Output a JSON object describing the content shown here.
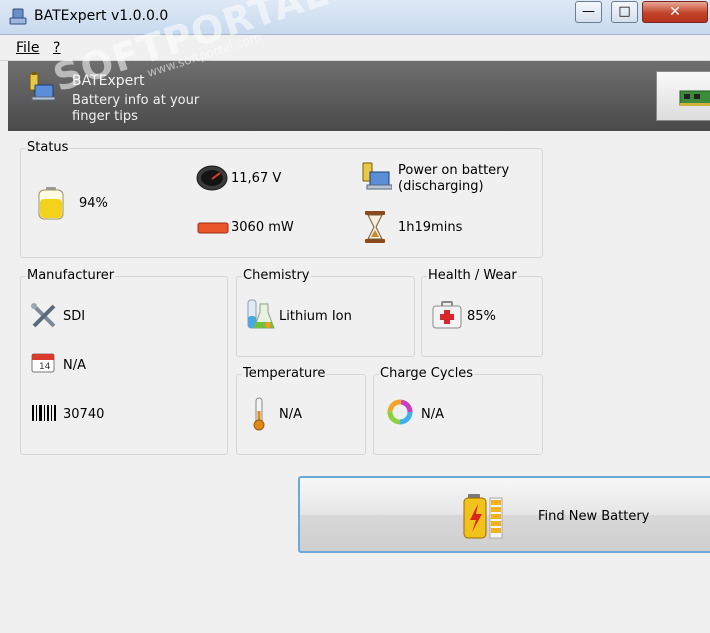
{
  "window": {
    "title": "BATExpert v1.0.0.0",
    "min_glyph": "—",
    "max_glyph": "□",
    "close_glyph": "✕"
  },
  "menu": {
    "file": "File",
    "help": "?"
  },
  "header": {
    "app_name": "BATExpert",
    "tagline": "Battery info at your finger tips"
  },
  "watermark": {
    "text": "SOFTPORTAL",
    "sub": "www.softportal.com"
  },
  "status": {
    "label": "Status",
    "charge": "94%",
    "voltage": "11,67 V",
    "power": "3060 mW",
    "power_source": "Power on battery (discharging)",
    "time_left": "1h19mins"
  },
  "manufacturer": {
    "label": "Manufacturer",
    "name": "SDI",
    "date": "N/A",
    "serial": "30740"
  },
  "chemistry": {
    "label": "Chemistry",
    "value": "Lithium Ion"
  },
  "health": {
    "label": "Health / Wear",
    "value": "85%"
  },
  "temperature": {
    "label": "Temperature",
    "value": "N/A"
  },
  "cycles": {
    "label": "Charge Cycles",
    "value": "N/A"
  },
  "find_battery": {
    "label": "Find New Battery"
  },
  "icons": {
    "app": "laptop-battery-icon",
    "charge": "battery-level-icon",
    "voltage": "gauge-icon",
    "power": "power-bar-icon",
    "source": "laptop-power-icon",
    "time": "hourglass-icon",
    "manufacturer": "tools-icon",
    "date": "calendar-icon",
    "serial": "barcode-icon",
    "chemistry": "flasks-icon",
    "health": "first-aid-icon",
    "temperature": "thermometer-icon",
    "cycles": "cycle-icon",
    "find": "battery-charge-icon"
  }
}
